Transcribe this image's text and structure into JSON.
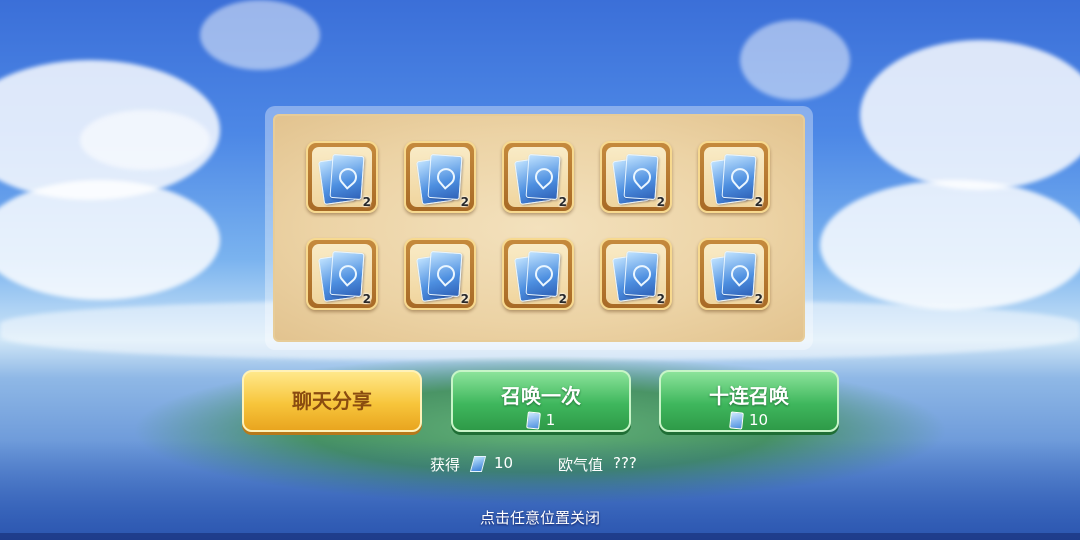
{
  "rewards": [
    {
      "item": "summon-card-icon",
      "count": "2"
    },
    {
      "item": "summon-card-icon",
      "count": "2"
    },
    {
      "item": "summon-card-icon",
      "count": "2"
    },
    {
      "item": "summon-card-icon",
      "count": "2"
    },
    {
      "item": "summon-card-icon",
      "count": "2"
    },
    {
      "item": "summon-card-icon",
      "count": "2"
    },
    {
      "item": "summon-card-icon",
      "count": "2"
    },
    {
      "item": "summon-card-icon",
      "count": "2"
    },
    {
      "item": "summon-card-icon",
      "count": "2"
    },
    {
      "item": "summon-card-icon",
      "count": "2"
    }
  ],
  "buttons": {
    "share": {
      "label": "聊天分享"
    },
    "summon_once": {
      "label": "召唤一次",
      "cost": "1"
    },
    "summon_ten": {
      "label": "十连召唤",
      "cost": "10"
    }
  },
  "stats": {
    "obtained_label": "获得",
    "obtained_value": "10",
    "luck_label": "欧气值",
    "luck_value": "???"
  },
  "close_hint": "点击任意位置关闭",
  "colors": {
    "gold": "#f7c53b",
    "green": "#3fb75d",
    "panel": "#ecd3a5"
  }
}
